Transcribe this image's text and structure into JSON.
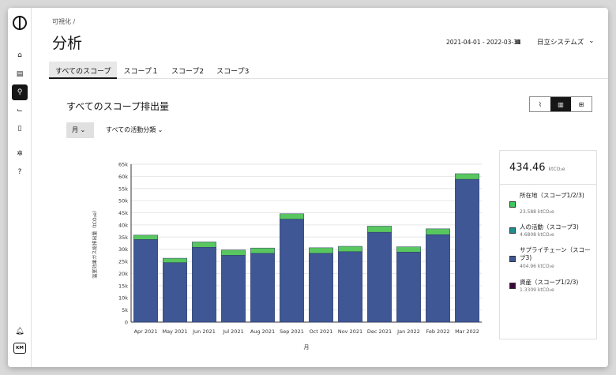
{
  "sidebar": {
    "icons": [
      "home-icon",
      "calculator-icon",
      "search-icon",
      "chart-icon",
      "document-icon",
      "gear-icon",
      "help-icon"
    ],
    "bottom": {
      "bell": "notification-icon",
      "avatar": "KM"
    }
  },
  "breadcrumb": "可視化 /",
  "page_title": "分析",
  "date_range": "2021-04-01 - 2022-03-31",
  "calendar_icon": "calendar-icon",
  "organization": "日立システムズ",
  "tabs": [
    "すべてのスコープ",
    "スコープ１",
    "スコープ2",
    "スコープ3"
  ],
  "section_title": "すべてのスコープ排出量",
  "view_toggle": [
    "line-chart-icon",
    "bar-chart-icon",
    "table-icon"
  ],
  "month_select": "月",
  "category_select": "すべての活動分類",
  "legend": {
    "total": "434.46",
    "total_unit": "ktCO₂e",
    "items": [
      {
        "label": "所在地（スコープ1/2/3)",
        "value": "23.588 ktCO₂e",
        "color": "#3fc95a"
      },
      {
        "label": "人の活動（スコープ3)",
        "value": "4.6808 ktCO₂e",
        "color": "#1f8f8f"
      },
      {
        "label": "サプライチェーン（スコープ3)",
        "value": "404.96 ktCO₂e",
        "color": "#3f5794"
      },
      {
        "label": "資産（スコープ1/2/3)",
        "value": "1.3309 ktCO₂e",
        "color": "#3b0a3a"
      }
    ]
  },
  "chart_data": {
    "type": "bar",
    "stacked": true,
    "categories": [
      "Apr 2021",
      "May 2021",
      "Jun 2021",
      "Jul 2021",
      "Aug 2021",
      "Sep 2021",
      "Oct 2021",
      "Nov 2021",
      "Dec 2021",
      "Jan 2022",
      "Feb 2022",
      "Mar 2022"
    ],
    "series": [
      {
        "name": "サプライチェーン（スコープ3)",
        "color": "#3f5794",
        "values": [
          34000,
          24500,
          30800,
          27500,
          28300,
          42400,
          28300,
          29000,
          37000,
          28800,
          36000,
          58800
        ]
      },
      {
        "name": "所在地（スコープ1/2/3)",
        "color": "#58c75f",
        "values": [
          1800,
          1800,
          2200,
          2200,
          2200,
          2200,
          2300,
          2200,
          2500,
          2200,
          2400,
          2300
        ]
      }
    ],
    "y_ticks": [
      "0",
      "5k",
      "10k",
      "15k",
      "20k",
      "25k",
      "30k",
      "35k",
      "40k",
      "45k",
      "50k",
      "55k",
      "60k",
      "65k"
    ],
    "ylim": [
      0,
      65000
    ],
    "xlabel": "月",
    "ylabel": "温室効果ガス総排出量（tCO₂e）",
    "grid": true
  }
}
